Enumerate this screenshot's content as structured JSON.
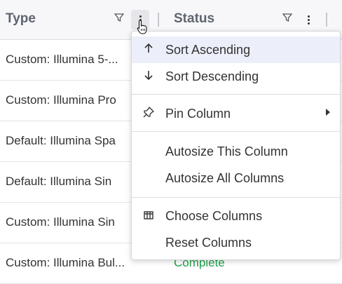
{
  "columns": {
    "type": {
      "title": "Type"
    },
    "status": {
      "title": "Status"
    }
  },
  "rows": [
    {
      "type": "Custom: Illumina 5-...",
      "status": ""
    },
    {
      "type": "Custom: Illumina Pro",
      "status": ""
    },
    {
      "type": "Default: Illumina Spa",
      "status": ""
    },
    {
      "type": "Default: Illumina Sin",
      "status": ""
    },
    {
      "type": "Custom: Illumina Sin",
      "status": ""
    },
    {
      "type": "Custom: Illumina Bul...",
      "status": "Complete"
    }
  ],
  "menu": {
    "sort_asc": "Sort Ascending",
    "sort_desc": "Sort Descending",
    "pin": "Pin Column",
    "autosize_this": "Autosize This Column",
    "autosize_all": "Autosize All Columns",
    "choose": "Choose Columns",
    "reset": "Reset Columns"
  },
  "colors": {
    "status_complete": "#1fa34a",
    "menu_highlight": "#eceefa"
  }
}
